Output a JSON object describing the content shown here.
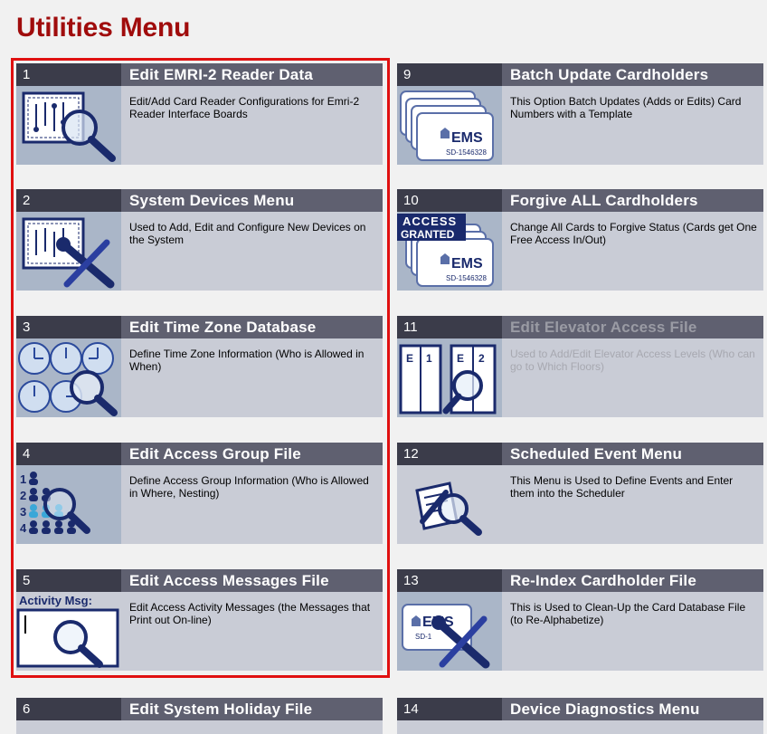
{
  "page": {
    "title": "Utilities Menu"
  },
  "colors": {
    "title": "#a00c0c",
    "highlight": "#e01010",
    "header": "#5f6070",
    "header_num": "#3b3c4a",
    "card": "#c9ccd6"
  },
  "menu": {
    "left": [
      {
        "num": "1",
        "title": "Edit EMRI-2 Reader Data",
        "desc": "Edit/Add Card Reader Configurations for Emri-2 Reader Interface Boards",
        "icon": "circuit-board-magnifier-icon"
      },
      {
        "num": "2",
        "title": "System Devices Menu",
        "desc": "Used to Add, Edit and Configure New Devices on the System",
        "icon": "circuit-board-tools-icon"
      },
      {
        "num": "3",
        "title": "Edit Time Zone Database",
        "desc": "Define Time Zone Information (Who is Allowed in When)",
        "icon": "clocks-magnifier-icon"
      },
      {
        "num": "4",
        "title": "Edit Access Group File",
        "desc": "Define Access Group Information (Who is Allowed in Where, Nesting)",
        "icon": "user-groups-magnifier-icon"
      },
      {
        "num": "5",
        "title": "Edit Access Messages File",
        "desc": "Edit Access Activity Messages (the Messages that Print out On-line)",
        "icon": "activity-message-magnifier-icon",
        "icon_text": "Activity Msg:"
      },
      {
        "num": "6",
        "title": "Edit System Holiday File"
      }
    ],
    "right": [
      {
        "num": "9",
        "title": "Batch Update Cardholders",
        "desc": "This Option Batch Updates (Adds or Edits) Card Numbers with a Template",
        "icon": "card-stack-icon",
        "card_brand": "EMS",
        "card_serial": "SD-1546328"
      },
      {
        "num": "10",
        "title": "Forgive ALL Cardholders",
        "desc": "Change All Cards to Forgive Status (Cards get One Free Access In/Out)",
        "icon": "access-granted-cards-icon",
        "badge_line1": "ACCESS",
        "badge_line2": "GRANTED",
        "card_brand": "EMS",
        "card_serial": "SD-1546328"
      },
      {
        "num": "11",
        "title": "Edit Elevator Access File",
        "desc": "Used to Add/Edit Elevator Access Levels (Who can go to Which Floors)",
        "icon": "elevator-magnifier-icon",
        "disabled": true,
        "door1_left": "E",
        "door1_right": "1",
        "door2_left": "E",
        "door2_right": "2"
      },
      {
        "num": "12",
        "title": "Scheduled Event Menu",
        "desc": "This Menu is Used to Define Events and Enter them into the Scheduler",
        "icon": "schedule-pencil-magnifier-icon"
      },
      {
        "num": "13",
        "title": "Re-Index Cardholder File",
        "desc": "This is Used to Clean-Up the Card Database File (to Re-Alphabetize)",
        "icon": "card-tools-icon",
        "card_brand": "EMS",
        "card_serial": "SD-1"
      },
      {
        "num": "14",
        "title": "Device Diagnostics Menu"
      }
    ]
  }
}
